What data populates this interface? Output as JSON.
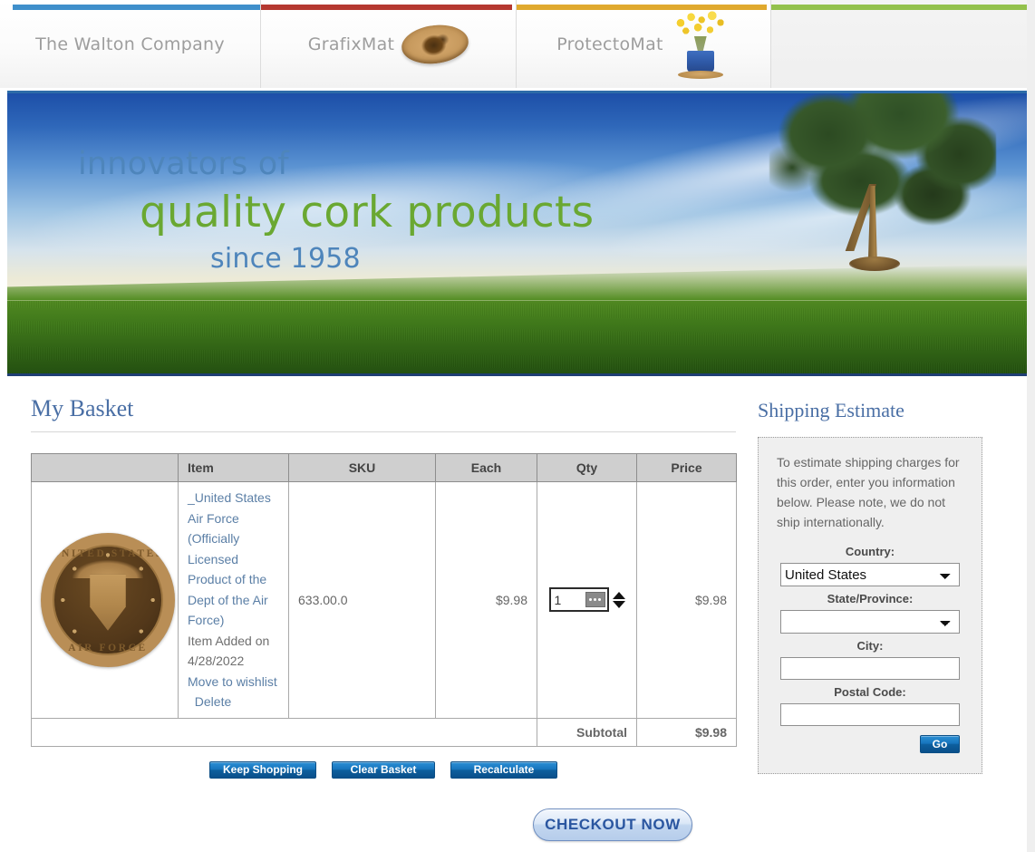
{
  "brand_tabs": [
    {
      "label": "The Walton Company",
      "accent": "#3f8fcb",
      "icon": ""
    },
    {
      "label": "GrafixMat",
      "accent": "#b53830",
      "icon": "cork-disc-icon"
    },
    {
      "label": "ProtectoMat",
      "accent": "#e0a92e",
      "icon": "flower-vase-icon"
    },
    {
      "label": "",
      "accent": "#93c14c",
      "icon": ""
    }
  ],
  "hero": {
    "line1": "innovators of",
    "line2": "quality cork products",
    "line3": "since 1958",
    "line1_color": "#4e85bb",
    "line2_color": "#6aa832",
    "line3_color": "#4e85bb"
  },
  "basket": {
    "title": "My Basket",
    "columns": [
      "",
      "Item",
      "SKU",
      "Each",
      "Qty",
      "Price"
    ],
    "row": {
      "image_alt": "United States Air Force cork coaster",
      "seal_top_text": "UNITED STATES",
      "seal_bottom_text": "AIR FORCE",
      "item_name": "_United States Air Force (Officially Licensed Product of the Dept of the Air Force)",
      "added_note": "Item Added on 4/28/2022",
      "move_to_wishlist": "Move to wishlist",
      "delete": "Delete",
      "sku": "633.00.0",
      "each": "$9.98",
      "qty": "1",
      "price": "$9.98"
    },
    "subtotal_label": "Subtotal",
    "subtotal_value": "$9.98"
  },
  "actions": {
    "keep_shopping": "Keep Shopping",
    "clear_basket": "Clear Basket",
    "recalculate": "Recalculate",
    "checkout": "CHECKOUT NOW"
  },
  "shipping": {
    "title": "Shipping Estimate",
    "note": "To estimate shipping charges for this order, enter you information below. Please note, we do not ship internationally.",
    "country_label": "Country:",
    "country_value": "United States",
    "country_options": [
      "United States"
    ],
    "state_label": "State/Province:",
    "state_value": "",
    "state_options": [
      ""
    ],
    "city_label": "City:",
    "city_value": "",
    "postal_label": "Postal Code:",
    "postal_value": "",
    "go": "Go"
  }
}
